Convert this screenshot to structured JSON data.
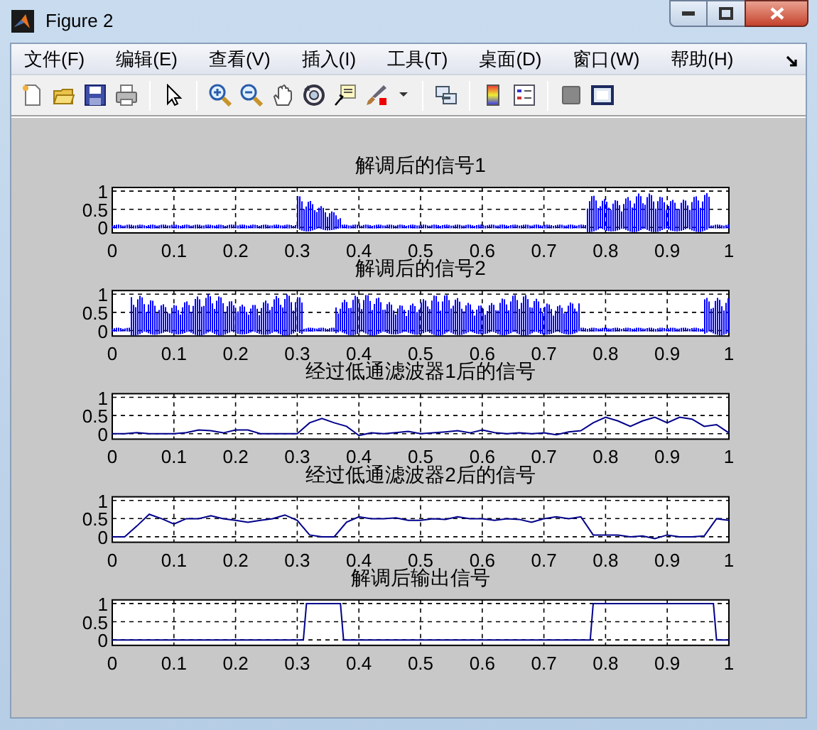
{
  "window": {
    "title": "Figure 2"
  },
  "menu": [
    {
      "label": "文件(F)"
    },
    {
      "label": "编辑(E)"
    },
    {
      "label": "查看(V)"
    },
    {
      "label": "插入(I)"
    },
    {
      "label": "工具(T)"
    },
    {
      "label": "桌面(D)"
    },
    {
      "label": "窗口(W)"
    },
    {
      "label": "帮助(H)"
    }
  ],
  "plots": [
    {
      "kind": "waveform",
      "title": "解调后的信号1",
      "color": "#0000ff",
      "xticks": [
        "0",
        "0.1",
        "0.2",
        "0.3",
        "0.4",
        "0.5",
        "0.6",
        "0.7",
        "0.8",
        "0.9",
        "1"
      ],
      "yticks": [
        "1",
        "0.5",
        "0"
      ]
    },
    {
      "kind": "waveform",
      "title": "解调后的信号2",
      "color": "#0000ff",
      "xticks": [
        "0",
        "0.1",
        "0.2",
        "0.3",
        "0.4",
        "0.5",
        "0.6",
        "0.7",
        "0.8",
        "0.9",
        "1"
      ],
      "yticks": [
        "1",
        "0.5",
        "0"
      ]
    },
    {
      "kind": "line",
      "chart_data": {
        "type": "line",
        "grid": true,
        "title": "经过低通滤波器1后的信号",
        "xlim": [
          0,
          1
        ],
        "ylim": [
          -0.15,
          1.1
        ],
        "xticks": [
          0,
          0.1,
          0.2,
          0.3,
          0.4,
          0.5,
          0.6,
          0.7,
          0.8,
          0.9,
          1
        ],
        "yticks": [
          0,
          0.5,
          1
        ],
        "x": [
          0,
          0.02,
          0.04,
          0.06,
          0.08,
          0.1,
          0.12,
          0.14,
          0.16,
          0.18,
          0.2,
          0.22,
          0.24,
          0.26,
          0.28,
          0.3,
          0.32,
          0.34,
          0.36,
          0.38,
          0.4,
          0.42,
          0.44,
          0.46,
          0.48,
          0.5,
          0.52,
          0.54,
          0.56,
          0.58,
          0.6,
          0.62,
          0.64,
          0.66,
          0.68,
          0.7,
          0.72,
          0.74,
          0.76,
          0.78,
          0.8,
          0.82,
          0.84,
          0.86,
          0.88,
          0.9,
          0.92,
          0.94,
          0.96,
          0.98,
          1
        ],
        "series": [
          {
            "color": "#00008b",
            "values": [
              0,
              0,
              0.03,
              0,
              0,
              0,
              0.03,
              0.1,
              0.08,
              0.02,
              0.1,
              0.1,
              0,
              0,
              0,
              0,
              0.3,
              0.42,
              0.3,
              0.2,
              -0.05,
              0.02,
              0,
              0.03,
              0.06,
              0,
              0.02,
              0.05,
              0.08,
              0.02,
              0.1,
              0.03,
              0,
              0.02,
              0,
              0.02,
              -0.03,
              0.05,
              0.08,
              0.3,
              0.45,
              0.35,
              0.2,
              0.35,
              0.45,
              0.3,
              0.45,
              0.4,
              0.2,
              0.25,
              0.02
            ]
          }
        ]
      }
    },
    {
      "kind": "line",
      "chart_data": {
        "type": "line",
        "grid": true,
        "title": "经过低通滤波器2后的信号",
        "xlim": [
          0,
          1
        ],
        "ylim": [
          -0.15,
          1.1
        ],
        "xticks": [
          0,
          0.1,
          0.2,
          0.3,
          0.4,
          0.5,
          0.6,
          0.7,
          0.8,
          0.9,
          1
        ],
        "yticks": [
          0,
          0.5,
          1
        ],
        "x": [
          0,
          0.02,
          0.04,
          0.06,
          0.08,
          0.1,
          0.12,
          0.14,
          0.16,
          0.18,
          0.2,
          0.22,
          0.24,
          0.26,
          0.28,
          0.3,
          0.32,
          0.34,
          0.36,
          0.38,
          0.4,
          0.42,
          0.44,
          0.46,
          0.48,
          0.5,
          0.52,
          0.54,
          0.56,
          0.58,
          0.6,
          0.62,
          0.64,
          0.66,
          0.68,
          0.7,
          0.72,
          0.74,
          0.76,
          0.78,
          0.8,
          0.82,
          0.84,
          0.86,
          0.88,
          0.9,
          0.92,
          0.94,
          0.96,
          0.98,
          1
        ],
        "series": [
          {
            "color": "#00008b",
            "values": [
              0,
              0,
              0.3,
              0.62,
              0.5,
              0.35,
              0.5,
              0.5,
              0.58,
              0.5,
              0.45,
              0.4,
              0.45,
              0.5,
              0.6,
              0.45,
              0.05,
              0,
              0,
              0.4,
              0.55,
              0.5,
              0.5,
              0.52,
              0.45,
              0.45,
              0.5,
              0.48,
              0.55,
              0.5,
              0.5,
              0.45,
              0.5,
              0.48,
              0.4,
              0.5,
              0.55,
              0.5,
              0.55,
              0.05,
              0.05,
              0.05,
              0,
              0.02,
              -0.05,
              0.05,
              0,
              0,
              0.02,
              0.5,
              0.45
            ]
          }
        ]
      }
    },
    {
      "kind": "line",
      "chart_data": {
        "type": "line",
        "grid": true,
        "title": "解调后输出信号",
        "xlim": [
          0,
          1
        ],
        "ylim": [
          -0.15,
          1.1
        ],
        "xticks": [
          0,
          0.1,
          0.2,
          0.3,
          0.4,
          0.5,
          0.6,
          0.7,
          0.8,
          0.9,
          1
        ],
        "yticks": [
          0,
          0.5,
          1
        ],
        "x": [
          0,
          0.31,
          0.315,
          0.37,
          0.375,
          0.775,
          0.78,
          0.975,
          0.98,
          1
        ],
        "series": [
          {
            "color": "#00008b",
            "values": [
              0,
              0,
              1,
              1,
              0,
              0,
              1,
              1,
              0,
              0
            ]
          }
        ]
      }
    }
  ]
}
